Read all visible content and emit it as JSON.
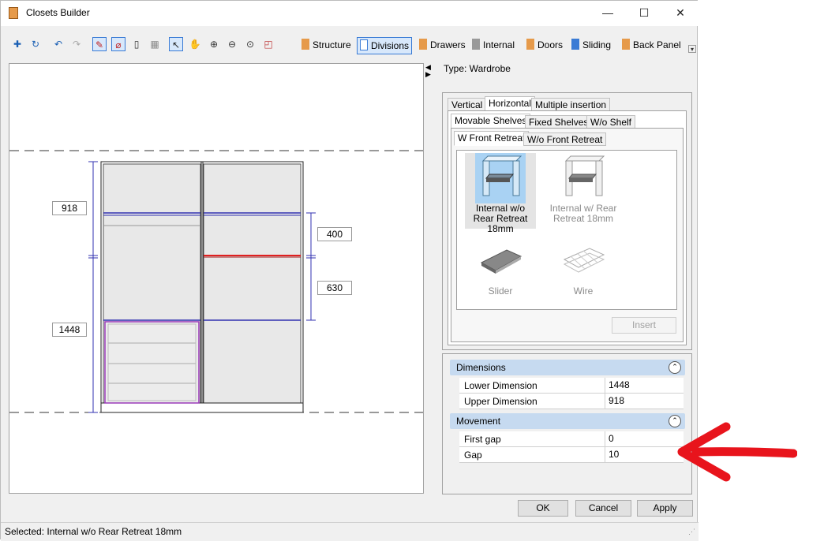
{
  "window": {
    "title": "Closets Builder",
    "minimize": "—",
    "maximize": "☐",
    "close": "✕"
  },
  "toolbar": {
    "tabs": [
      {
        "label": "Structure",
        "icon": "structure-icon"
      },
      {
        "label": "Divisions",
        "icon": "grid-icon",
        "selected": true
      },
      {
        "label": "Drawers",
        "icon": "drawer-icon"
      },
      {
        "label": "Internal",
        "icon": "internal-icon"
      },
      {
        "label": "Doors",
        "icon": "door-icon"
      },
      {
        "label": "Sliding",
        "icon": "sliding-icon"
      },
      {
        "label": "Back Panel",
        "icon": "back-panel-icon"
      }
    ]
  },
  "canvas": {
    "dimensions": {
      "upper_left": "918",
      "lower_left": "1448",
      "upper_right": "400",
      "lower_right": "630"
    }
  },
  "panel": {
    "type_label": "Type: Wardrobe",
    "tabs_level1": [
      "Vertical",
      "Horizontal",
      "Multiple insertion"
    ],
    "tabs_level2": [
      "Movable Shelves",
      "Fixed Shelves",
      "W/o Shelf"
    ],
    "tabs_level3": [
      "W Front Retreat",
      "W/o Front Retreat"
    ],
    "gallery": [
      {
        "label": "Internal w/o Rear Retreat 18mm",
        "selected": true
      },
      {
        "label": "Internal w/ Rear Retreat 18mm"
      },
      {
        "label": "Slider"
      },
      {
        "label": "Wire"
      }
    ],
    "insert_label": "Insert"
  },
  "properties": {
    "dimensions_title": "Dimensions",
    "lower_label": "Lower Dimension",
    "lower_value": "1448",
    "upper_label": "Upper Dimension",
    "upper_value": "918",
    "movement_title": "Movement",
    "first_gap_label": "First gap",
    "first_gap_value": "0",
    "gap_label": "Gap",
    "gap_value": "10"
  },
  "buttons": {
    "ok": "OK",
    "cancel": "Cancel",
    "apply": "Apply"
  },
  "status": {
    "text": "Selected: Internal w/o Rear Retreat 18mm"
  },
  "colors": {
    "accent": "#3a7bd5",
    "annotation_arrow": "#e8141c",
    "selected_shelf": "#e02020",
    "division_line": "#3030b0"
  }
}
